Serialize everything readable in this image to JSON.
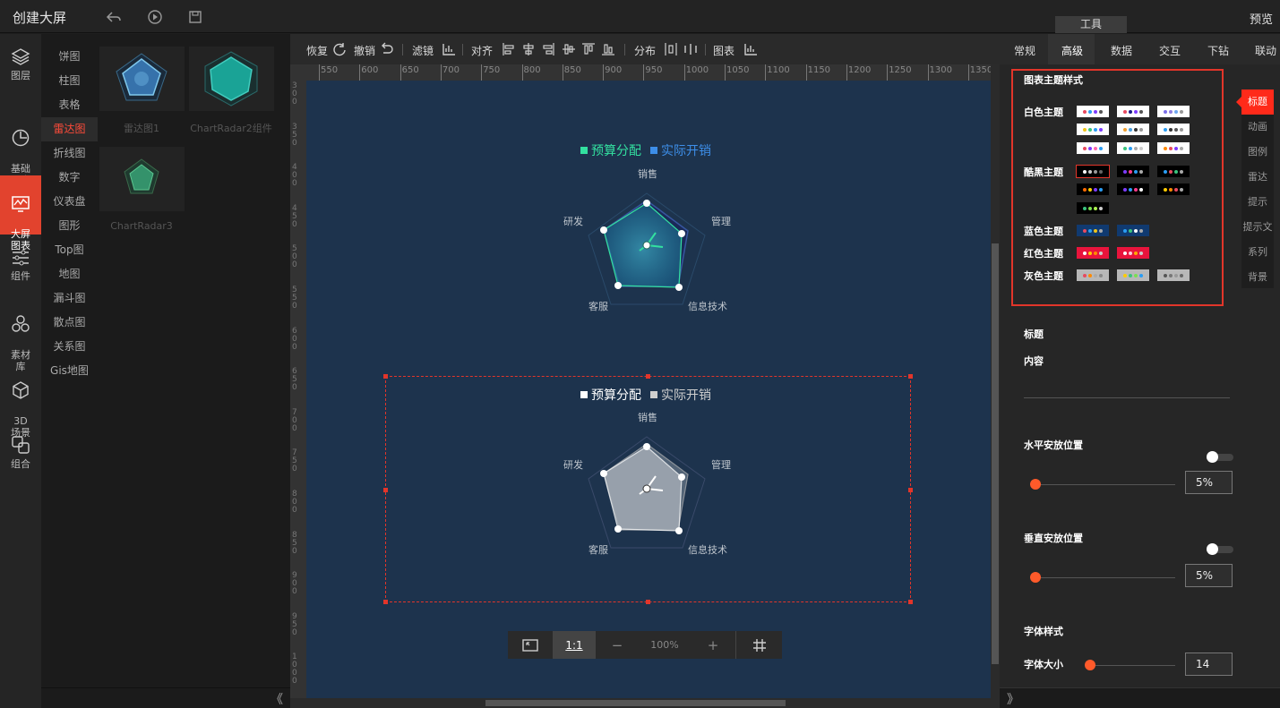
{
  "app": {
    "title": "创建大屏",
    "preview_label": "预览",
    "tool_tag": "工具"
  },
  "left_nav": [
    {
      "label": "图层",
      "icon": "layers-icon"
    },
    {
      "label": "基础\n图表",
      "icon": "clock-chart-icon"
    },
    {
      "label": "大屏\n图表",
      "icon": "bigscreen-chart-icon"
    },
    {
      "label": "组件",
      "icon": "sliders-icon"
    },
    {
      "label": "素材\n库",
      "icon": "material-icon"
    },
    {
      "label": "3D\n场景",
      "icon": "cube-icon"
    },
    {
      "label": "组合",
      "icon": "group-icon"
    }
  ],
  "categories": [
    "饼图",
    "柱图",
    "表格",
    "雷达图",
    "折线图",
    "数字",
    "仪表盘",
    "图形",
    "Top图",
    "地图",
    "漏斗图",
    "散点图",
    "关系图",
    "Gis地图"
  ],
  "active_category": "雷达图",
  "thumbnails": [
    {
      "caption": "雷达图1"
    },
    {
      "caption": "ChartRadar2组件"
    },
    {
      "caption": "ChartRadar3"
    }
  ],
  "toolbar": {
    "redo": "恢复",
    "undo": "撤销",
    "filter": "滤镜",
    "align": "对齐",
    "distribute": "分布",
    "chart": "图表"
  },
  "ruler_labels": [
    "550",
    "600",
    "650",
    "700",
    "750",
    "800",
    "850",
    "900",
    "950",
    "1000",
    "1050",
    "1100",
    "1150",
    "1200",
    "1250",
    "1300",
    "1350"
  ],
  "vruler_labels": [
    "300",
    "350",
    "400",
    "450",
    "500",
    "550",
    "600",
    "650",
    "700",
    "750",
    "800",
    "850",
    "900",
    "950",
    "1000"
  ],
  "charts": [
    {
      "legend": [
        {
          "name": "预算分配",
          "color": "#33e0a0"
        },
        {
          "name": "实际开销",
          "color": "#3d8ee8"
        }
      ],
      "indicators": [
        "销售",
        "管理",
        "信息技术",
        "客服",
        "研发"
      ]
    },
    {
      "legend": [
        {
          "name": "预算分配",
          "color": "#ffffff"
        },
        {
          "name": "实际开销",
          "color": "#cfcfcf"
        }
      ],
      "indicators": [
        "销售",
        "管理",
        "信息技术",
        "客服",
        "研发"
      ]
    }
  ],
  "zoom": {
    "fit_label": "",
    "ratio_label": "1:1",
    "minus": "−",
    "value": "100%",
    "plus": "+"
  },
  "right_tabs": [
    "常规",
    "高级",
    "数据",
    "交互",
    "下钻",
    "联动"
  ],
  "active_right_tab": "高级",
  "theme_section": {
    "title": "图表主题样式",
    "groups": [
      {
        "label": "白色主题",
        "bg": "#ffffff",
        "palettes": [
          [
            "#e84a5f",
            "#2a9df4",
            "#7d3cff",
            "#555"
          ],
          [
            "#e84a5f",
            "#1a1a8a",
            "#7d3cff",
            "#555"
          ],
          [
            "#7b6ee8",
            "#8e7de0",
            "#6ea7f0",
            "#999"
          ],
          [
            "#f0c419",
            "#3ac47d",
            "#2a9df4",
            "#7d3cff"
          ],
          [
            "#f0a030",
            "#4aa0e0",
            "#333",
            "#999"
          ],
          [
            "#2a9df4",
            "#333",
            "#555",
            "#999"
          ],
          [
            "#e84a5f",
            "#7d3cff",
            "#ff66aa",
            "#2a9df4"
          ],
          [
            "#3ac47d",
            "#2a9df4",
            "#aaa",
            "#ccc"
          ],
          [
            "#ff8a00",
            "#e84a5f",
            "#7d3cff",
            "#aaa"
          ]
        ]
      },
      {
        "label": "酷黑主题",
        "bg": "#000000",
        "palettes": [
          [
            "#fff",
            "#ccc",
            "#999",
            "#666"
          ],
          [
            "#7d3cff",
            "#ff3a8a",
            "#2a9df4",
            "#aaa"
          ],
          [
            "#2a9df4",
            "#e84a5f",
            "#3ac47d",
            "#aaa"
          ],
          [
            "#ff6a00",
            "#ffcc00",
            "#7d3cff",
            "#2a9df4"
          ],
          [
            "#7d3cff",
            "#2a9df4",
            "#ff3a8a",
            "#fff"
          ],
          [
            "#ffcc00",
            "#ff8a00",
            "#e84a5f",
            "#aaa"
          ],
          [
            "#3ac47d",
            "#7ae050",
            "#aaf050",
            "#ccc"
          ]
        ]
      },
      {
        "label": "蓝色主题",
        "bg": "#103a70",
        "palettes": [
          [
            "#e84a5f",
            "#2a9df4",
            "#f0c419",
            "#aaa"
          ],
          [
            "#2a9df4",
            "#3ac47d",
            "#fff",
            "#aaa"
          ]
        ]
      },
      {
        "label": "红色主题",
        "bg": "#e8143c",
        "palettes": [
          [
            "#fff",
            "#ffcc00",
            "#ff8a00",
            "#ccc"
          ],
          [
            "#fff",
            "#ffccdd",
            "#ffaa00",
            "#ccc"
          ]
        ]
      },
      {
        "label": "灰色主题",
        "bg": "#b8b8b8",
        "palettes": [
          [
            "#e84a5f",
            "#ff8a00",
            "#aaa",
            "#888"
          ],
          [
            "#ffcc00",
            "#3ac47d",
            "#7ae050",
            "#2a9df4"
          ],
          [
            "#555",
            "#777",
            "#999",
            "#666"
          ]
        ]
      }
    ]
  },
  "side_tabs": [
    "标题",
    "动画",
    "图例",
    "雷达",
    "提示",
    "提示文",
    "系列",
    "背景"
  ],
  "active_side_tab": "标题",
  "title_section": {
    "heading": "标题",
    "content_label": "内容",
    "content_value": "",
    "h_pos_label": "水平安放位置",
    "h_pos_value": "5%",
    "h_pos_fraction": 0.05,
    "v_pos_label": "垂直安放位置",
    "v_pos_value": "5%",
    "v_pos_fraction": 0.05,
    "font_style_label": "字体样式",
    "font_size_label": "字体大小",
    "font_size_value": "14"
  },
  "collapse_left": "《",
  "collapse_right": "》"
}
